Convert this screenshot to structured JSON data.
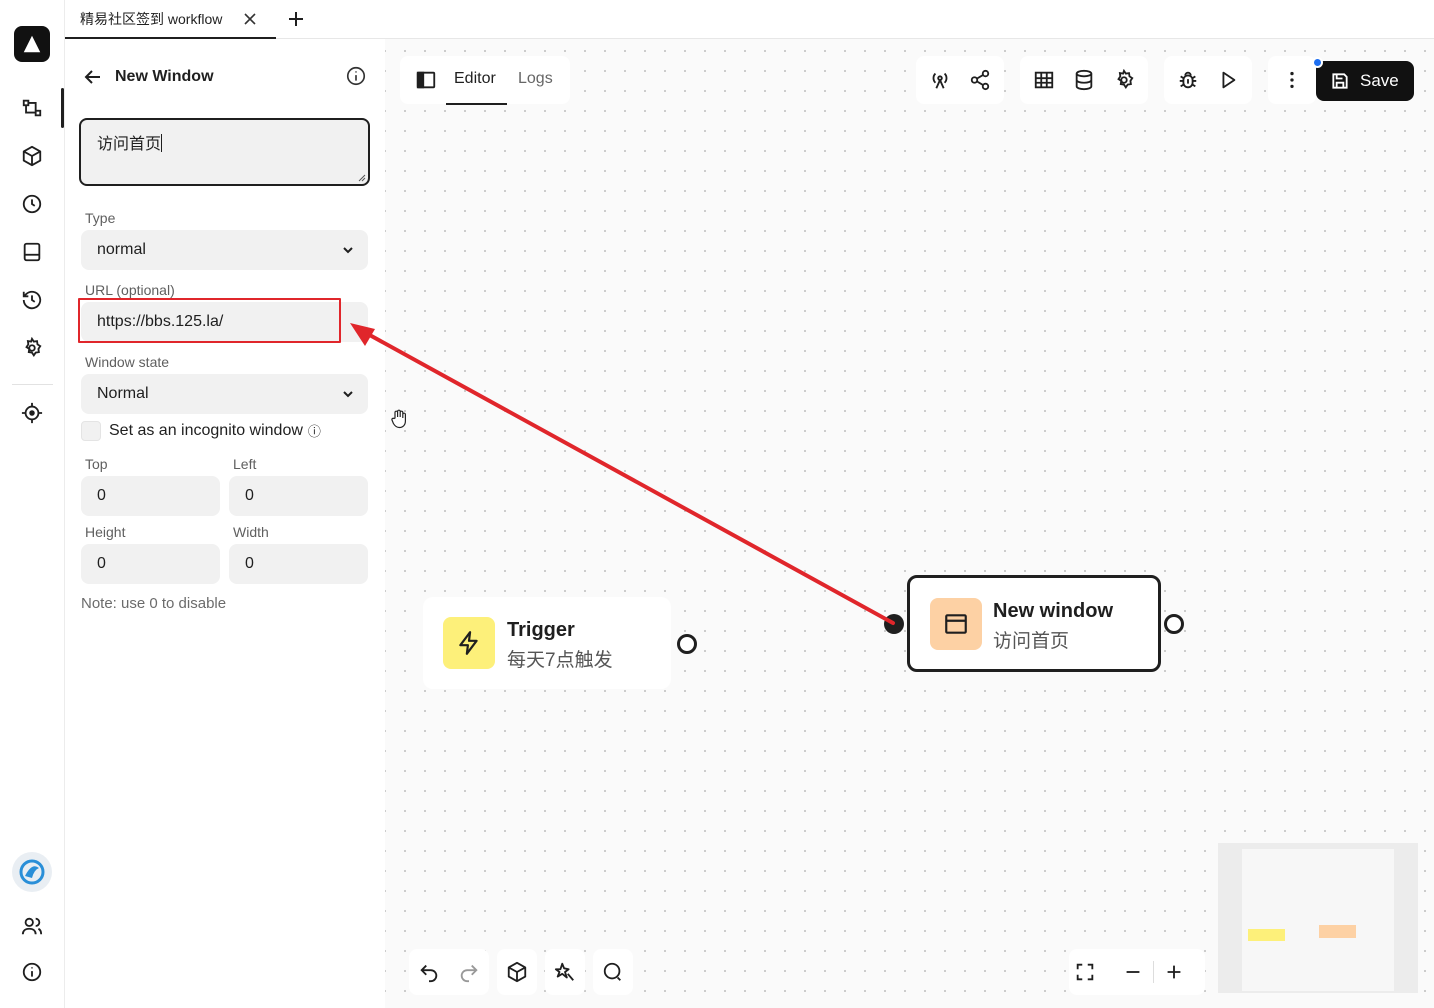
{
  "tab": {
    "title": "精易社区签到 workflow"
  },
  "panel": {
    "title": "New Window",
    "description": "访问首页",
    "type": {
      "label": "Type",
      "value": "normal"
    },
    "url": {
      "label": "URL (optional)",
      "value": "https://bbs.125.la/"
    },
    "window_state": {
      "label": "Window state",
      "value": "Normal"
    },
    "incognito": {
      "label": "Set as an incognito window",
      "info": "ⓘ",
      "checked": false
    },
    "top": {
      "label": "Top",
      "value": "0"
    },
    "left": {
      "label": "Left",
      "value": "0"
    },
    "height": {
      "label": "Height",
      "value": "0"
    },
    "width": {
      "label": "Width",
      "value": "0"
    },
    "note": "Note: use 0 to disable"
  },
  "editor": {
    "tabs": [
      "Editor",
      "Logs"
    ],
    "active_tab": "Editor",
    "save_label": "Save"
  },
  "nodes": {
    "trigger": {
      "title": "Trigger",
      "subtitle": "每天7点触发",
      "icon": "lightning-icon",
      "color": "#fdf07a"
    },
    "new_window": {
      "title": "New window",
      "subtitle": "访问首页",
      "icon": "browser-window-icon",
      "color": "#fdd1a4"
    }
  },
  "colors": {
    "annotation": "#e0262b",
    "accent": "#1e6ff1",
    "dark": "#111111"
  }
}
